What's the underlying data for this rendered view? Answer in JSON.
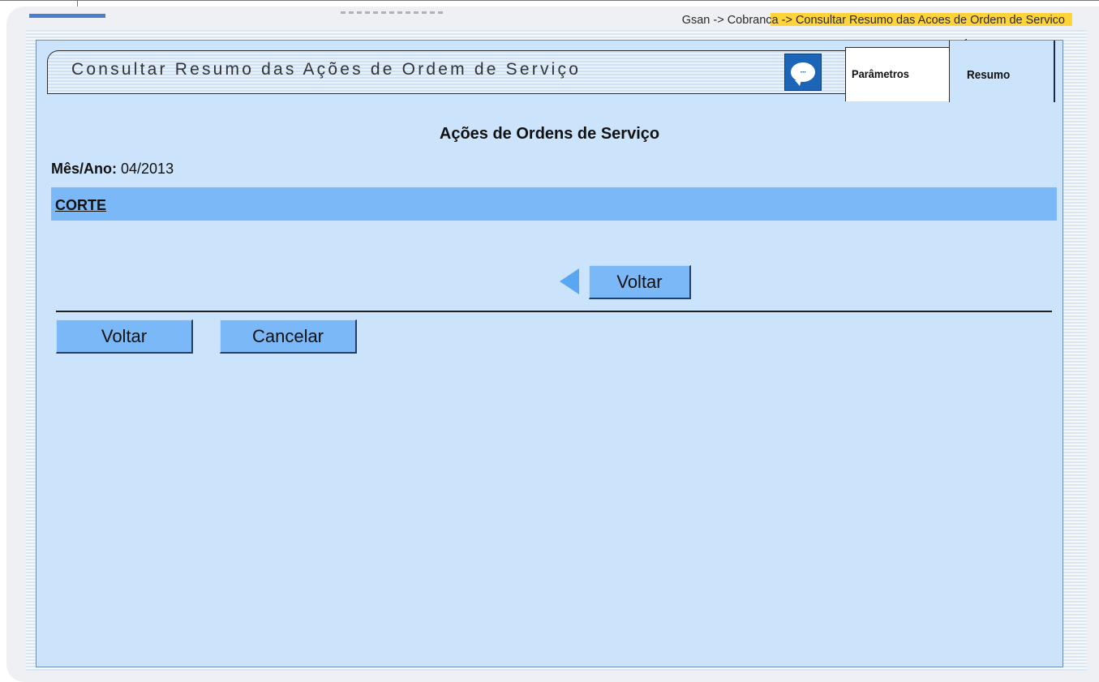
{
  "breadcrumb": "Gsan -> Cobranca -> Consultar Resumo das Acoes de Ordem de Servico",
  "header": {
    "title": "Consultar Resumo das Ações de Ordem de Serviço",
    "help_icon": "chat-bubble-icon"
  },
  "tabs": [
    {
      "label": "Parâmetros",
      "active": false
    },
    {
      "label": "Resumo",
      "active": true
    }
  ],
  "section": {
    "title": "Ações de Ordens de Serviço",
    "period_label": "Mês/Ano:",
    "period_value": "04/2013",
    "group_label": "CORTE"
  },
  "buttons": {
    "voltar_nav": "Voltar",
    "voltar": "Voltar",
    "cancelar": "Cancelar"
  },
  "colors": {
    "background": "#cce4fb",
    "group_bar": "#7ab8f7",
    "button": "#7ab8f7",
    "accent": "#1b64b8",
    "breadcrumb_highlight": "#ffd43b"
  }
}
